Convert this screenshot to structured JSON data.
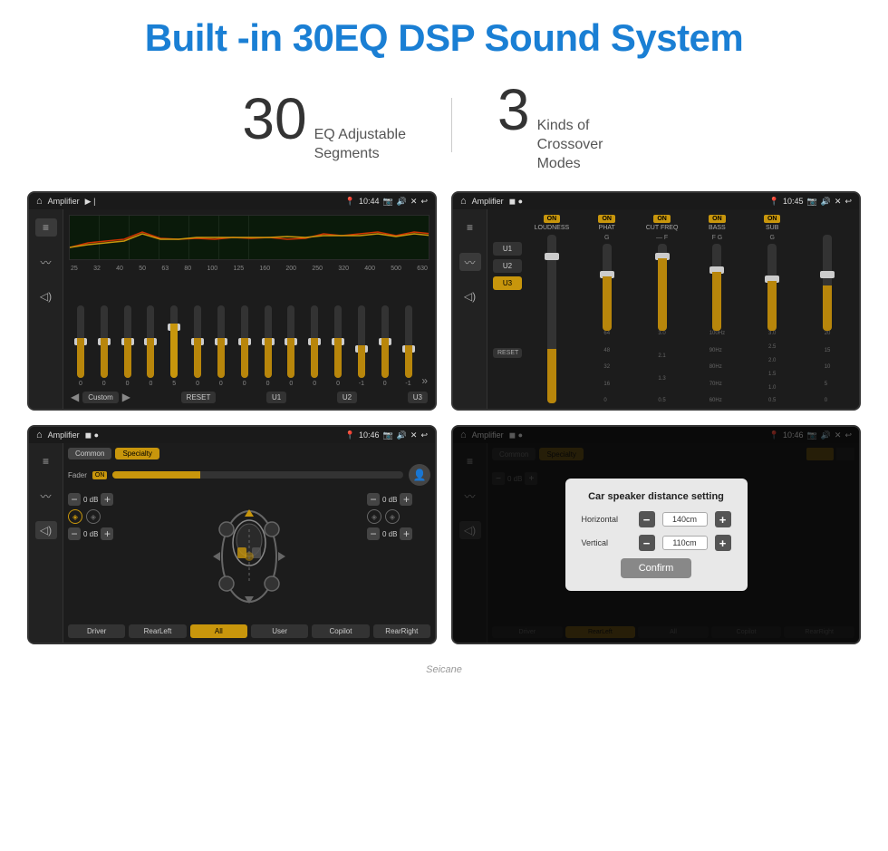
{
  "header": {
    "title": "Built -in 30EQ DSP Sound System"
  },
  "stats": [
    {
      "number": "30",
      "desc": "EQ Adjustable\nSegments"
    },
    {
      "number": "3",
      "desc": "Kinds of\nCrossover Modes"
    }
  ],
  "screens": [
    {
      "id": "screen1",
      "label": "EQ Graphic Equalizer",
      "statusbar": {
        "app": "Amplifier",
        "time": "10:44"
      },
      "freqs": [
        "25",
        "32",
        "40",
        "50",
        "63",
        "80",
        "100",
        "125",
        "160",
        "200",
        "250",
        "320",
        "400",
        "500",
        "630"
      ],
      "values": [
        "0",
        "0",
        "0",
        "0",
        "5",
        "0",
        "0",
        "0",
        "0",
        "0",
        "0",
        "0",
        "-1",
        "0",
        "-1"
      ],
      "preset": "Custom",
      "buttons": [
        "RESET",
        "U1",
        "U2",
        "U3"
      ]
    },
    {
      "id": "screen2",
      "label": "Crossover",
      "statusbar": {
        "app": "Amplifier",
        "time": "10:45"
      },
      "channels": [
        "LOUDNESS",
        "PHAT",
        "CUT FREQ",
        "BASS",
        "SUB"
      ],
      "uButtons": [
        "U1",
        "U2",
        "U3"
      ],
      "activeU": "U3"
    },
    {
      "id": "screen3",
      "label": "Speaker Config",
      "statusbar": {
        "app": "Amplifier",
        "time": "10:46"
      },
      "tabs": [
        "Common",
        "Specialty"
      ],
      "activeTab": "Specialty",
      "faderLabel": "Fader",
      "faderOn": "ON",
      "speakerButtons": [
        "Driver",
        "RearLeft",
        "All",
        "User",
        "Copilot",
        "RearRight"
      ],
      "volumes": [
        "0 dB",
        "0 dB",
        "0 dB",
        "0 dB"
      ]
    },
    {
      "id": "screen4",
      "label": "Distance Setting Dialog",
      "statusbar": {
        "app": "Amplifier",
        "time": "10:46"
      },
      "tabs": [
        "Common",
        "Specialty"
      ],
      "dialog": {
        "title": "Car speaker distance setting",
        "horizontal_label": "Horizontal",
        "horizontal_value": "140cm",
        "vertical_label": "Vertical",
        "vertical_value": "110cm",
        "confirm_label": "Confirm"
      }
    }
  ],
  "watermark": "Seicane"
}
